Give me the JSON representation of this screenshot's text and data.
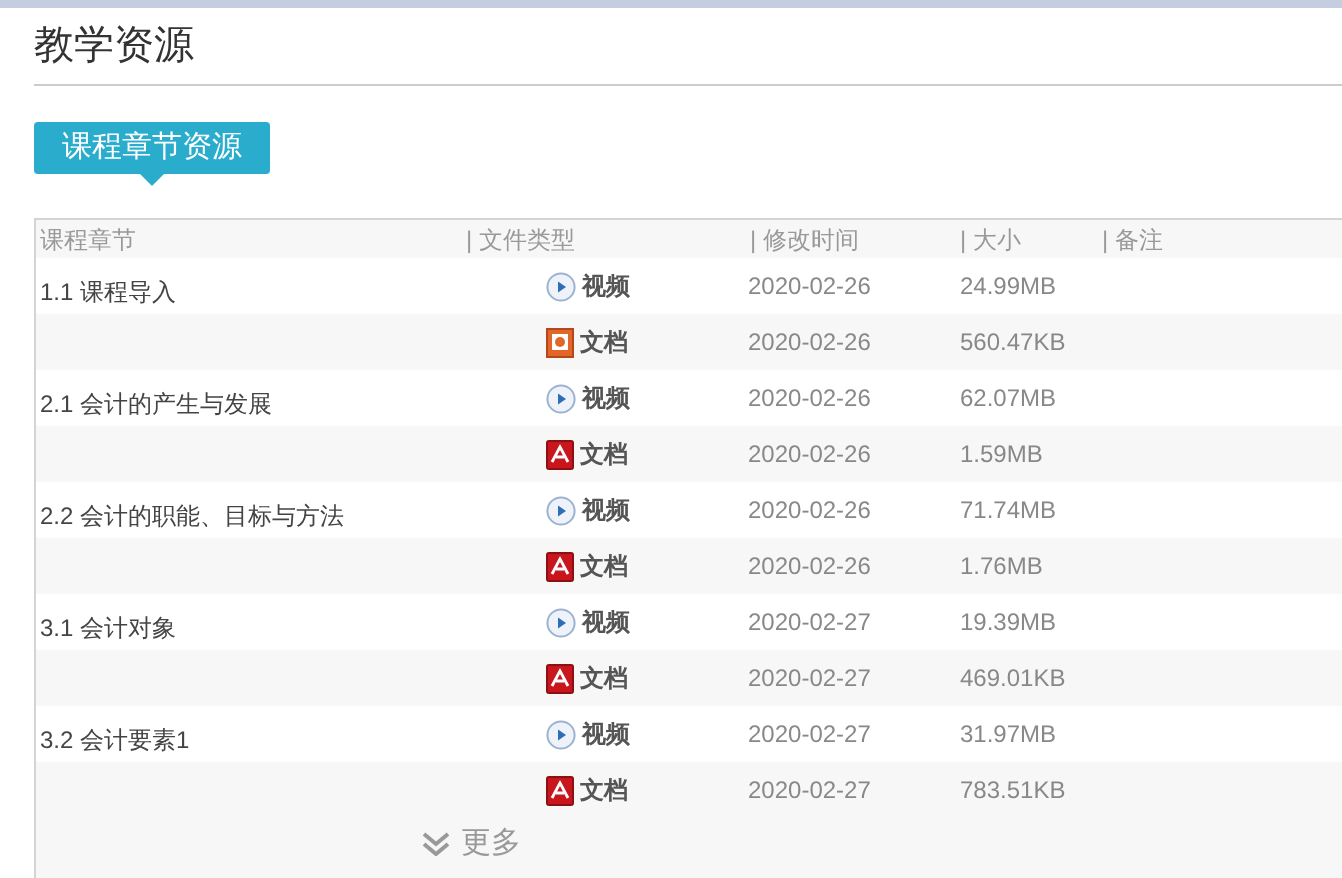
{
  "page_title": "教学资源",
  "tabs": [
    {
      "label": "课程章节资源",
      "selected": true
    }
  ],
  "table": {
    "columns": [
      "课程章节",
      "| 文件类型",
      "| 修改时间",
      "| 大小",
      "| 备注"
    ],
    "groups": [
      {
        "chapter": "1.1 课程导入",
        "files": [
          {
            "kind": "video",
            "type": "视频",
            "date": "2020-02-26",
            "size": "24.99MB"
          },
          {
            "kind": "ppt",
            "type": "文档",
            "date": "2020-02-26",
            "size": "560.47KB"
          }
        ]
      },
      {
        "chapter": "2.1 会计的产生与发展",
        "files": [
          {
            "kind": "video",
            "type": "视频",
            "date": "2020-02-26",
            "size": "62.07MB"
          },
          {
            "kind": "pdf",
            "type": "文档",
            "date": "2020-02-26",
            "size": "1.59MB"
          }
        ]
      },
      {
        "chapter": "2.2 会计的职能、目标与方法",
        "files": [
          {
            "kind": "video",
            "type": "视频",
            "date": "2020-02-26",
            "size": "71.74MB"
          },
          {
            "kind": "pdf",
            "type": "文档",
            "date": "2020-02-26",
            "size": "1.76MB"
          }
        ]
      },
      {
        "chapter": "3.1 会计对象",
        "files": [
          {
            "kind": "video",
            "type": "视频",
            "date": "2020-02-27",
            "size": "19.39MB"
          },
          {
            "kind": "pdf",
            "type": "文档",
            "date": "2020-02-27",
            "size": "469.01KB"
          }
        ]
      },
      {
        "chapter": "3.2 会计要素1",
        "files": [
          {
            "kind": "video",
            "type": "视频",
            "date": "2020-02-27",
            "size": "31.97MB"
          },
          {
            "kind": "pdf",
            "type": "文档",
            "date": "2020-02-27",
            "size": "783.51KB"
          }
        ]
      }
    ]
  },
  "more_button": "更多"
}
